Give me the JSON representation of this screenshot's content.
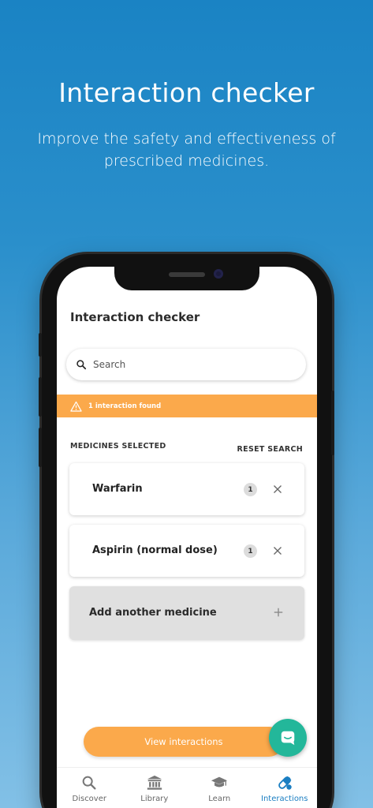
{
  "promo": {
    "title": "Interaction checker",
    "subtitle": "Improve the safety and effectiveness of prescribed medicines."
  },
  "screen": {
    "title": "Interaction checker",
    "search": {
      "placeholder": "Search",
      "icon": "search-icon"
    },
    "alert": {
      "text": "1 interaction found",
      "icon": "warning-icon",
      "color": "#fba94b"
    },
    "section_label": "MEDICINES SELECTED",
    "reset_label": "RESET SEARCH",
    "medicines": [
      {
        "name": "Warfarin",
        "count": "1"
      },
      {
        "name": "Aspirin (normal dose)",
        "count": "1"
      }
    ],
    "add_label": "Add another medicine",
    "view_button": "View interactions",
    "chat_icon": "chat-icon"
  },
  "tabs": [
    {
      "label": "Discover",
      "icon": "search-icon",
      "active": false
    },
    {
      "label": "Library",
      "icon": "library-icon",
      "active": false
    },
    {
      "label": "Learn",
      "icon": "graduation-cap-icon",
      "active": false
    },
    {
      "label": "Interactions",
      "icon": "pills-icon",
      "active": true
    }
  ],
  "colors": {
    "accent": "#fba94b",
    "brand_blue": "#1a7ec2",
    "chat_green": "#23b79a"
  }
}
